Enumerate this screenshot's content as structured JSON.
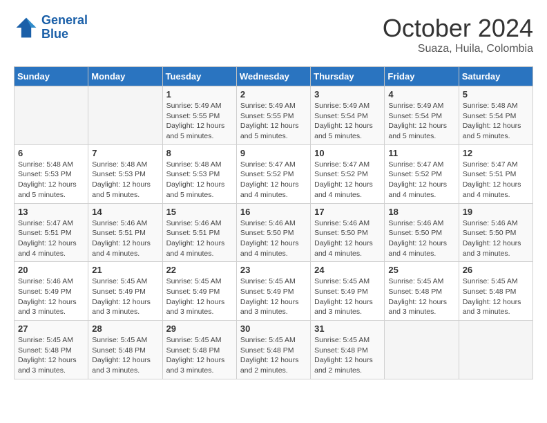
{
  "header": {
    "logo_line1": "General",
    "logo_line2": "Blue",
    "month": "October 2024",
    "location": "Suaza, Huila, Colombia"
  },
  "days_of_week": [
    "Sunday",
    "Monday",
    "Tuesday",
    "Wednesday",
    "Thursday",
    "Friday",
    "Saturday"
  ],
  "weeks": [
    [
      {
        "day": "",
        "info": ""
      },
      {
        "day": "",
        "info": ""
      },
      {
        "day": "1",
        "info": "Sunrise: 5:49 AM\nSunset: 5:55 PM\nDaylight: 12 hours\nand 5 minutes."
      },
      {
        "day": "2",
        "info": "Sunrise: 5:49 AM\nSunset: 5:55 PM\nDaylight: 12 hours\nand 5 minutes."
      },
      {
        "day": "3",
        "info": "Sunrise: 5:49 AM\nSunset: 5:54 PM\nDaylight: 12 hours\nand 5 minutes."
      },
      {
        "day": "4",
        "info": "Sunrise: 5:49 AM\nSunset: 5:54 PM\nDaylight: 12 hours\nand 5 minutes."
      },
      {
        "day": "5",
        "info": "Sunrise: 5:48 AM\nSunset: 5:54 PM\nDaylight: 12 hours\nand 5 minutes."
      }
    ],
    [
      {
        "day": "6",
        "info": "Sunrise: 5:48 AM\nSunset: 5:53 PM\nDaylight: 12 hours\nand 5 minutes."
      },
      {
        "day": "7",
        "info": "Sunrise: 5:48 AM\nSunset: 5:53 PM\nDaylight: 12 hours\nand 5 minutes."
      },
      {
        "day": "8",
        "info": "Sunrise: 5:48 AM\nSunset: 5:53 PM\nDaylight: 12 hours\nand 5 minutes."
      },
      {
        "day": "9",
        "info": "Sunrise: 5:47 AM\nSunset: 5:52 PM\nDaylight: 12 hours\nand 4 minutes."
      },
      {
        "day": "10",
        "info": "Sunrise: 5:47 AM\nSunset: 5:52 PM\nDaylight: 12 hours\nand 4 minutes."
      },
      {
        "day": "11",
        "info": "Sunrise: 5:47 AM\nSunset: 5:52 PM\nDaylight: 12 hours\nand 4 minutes."
      },
      {
        "day": "12",
        "info": "Sunrise: 5:47 AM\nSunset: 5:51 PM\nDaylight: 12 hours\nand 4 minutes."
      }
    ],
    [
      {
        "day": "13",
        "info": "Sunrise: 5:47 AM\nSunset: 5:51 PM\nDaylight: 12 hours\nand 4 minutes."
      },
      {
        "day": "14",
        "info": "Sunrise: 5:46 AM\nSunset: 5:51 PM\nDaylight: 12 hours\nand 4 minutes."
      },
      {
        "day": "15",
        "info": "Sunrise: 5:46 AM\nSunset: 5:51 PM\nDaylight: 12 hours\nand 4 minutes."
      },
      {
        "day": "16",
        "info": "Sunrise: 5:46 AM\nSunset: 5:50 PM\nDaylight: 12 hours\nand 4 minutes."
      },
      {
        "day": "17",
        "info": "Sunrise: 5:46 AM\nSunset: 5:50 PM\nDaylight: 12 hours\nand 4 minutes."
      },
      {
        "day": "18",
        "info": "Sunrise: 5:46 AM\nSunset: 5:50 PM\nDaylight: 12 hours\nand 4 minutes."
      },
      {
        "day": "19",
        "info": "Sunrise: 5:46 AM\nSunset: 5:50 PM\nDaylight: 12 hours\nand 3 minutes."
      }
    ],
    [
      {
        "day": "20",
        "info": "Sunrise: 5:46 AM\nSunset: 5:49 PM\nDaylight: 12 hours\nand 3 minutes."
      },
      {
        "day": "21",
        "info": "Sunrise: 5:45 AM\nSunset: 5:49 PM\nDaylight: 12 hours\nand 3 minutes."
      },
      {
        "day": "22",
        "info": "Sunrise: 5:45 AM\nSunset: 5:49 PM\nDaylight: 12 hours\nand 3 minutes."
      },
      {
        "day": "23",
        "info": "Sunrise: 5:45 AM\nSunset: 5:49 PM\nDaylight: 12 hours\nand 3 minutes."
      },
      {
        "day": "24",
        "info": "Sunrise: 5:45 AM\nSunset: 5:49 PM\nDaylight: 12 hours\nand 3 minutes."
      },
      {
        "day": "25",
        "info": "Sunrise: 5:45 AM\nSunset: 5:48 PM\nDaylight: 12 hours\nand 3 minutes."
      },
      {
        "day": "26",
        "info": "Sunrise: 5:45 AM\nSunset: 5:48 PM\nDaylight: 12 hours\nand 3 minutes."
      }
    ],
    [
      {
        "day": "27",
        "info": "Sunrise: 5:45 AM\nSunset: 5:48 PM\nDaylight: 12 hours\nand 3 minutes."
      },
      {
        "day": "28",
        "info": "Sunrise: 5:45 AM\nSunset: 5:48 PM\nDaylight: 12 hours\nand 3 minutes."
      },
      {
        "day": "29",
        "info": "Sunrise: 5:45 AM\nSunset: 5:48 PM\nDaylight: 12 hours\nand 3 minutes."
      },
      {
        "day": "30",
        "info": "Sunrise: 5:45 AM\nSunset: 5:48 PM\nDaylight: 12 hours\nand 2 minutes."
      },
      {
        "day": "31",
        "info": "Sunrise: 5:45 AM\nSunset: 5:48 PM\nDaylight: 12 hours\nand 2 minutes."
      },
      {
        "day": "",
        "info": ""
      },
      {
        "day": "",
        "info": ""
      }
    ]
  ]
}
